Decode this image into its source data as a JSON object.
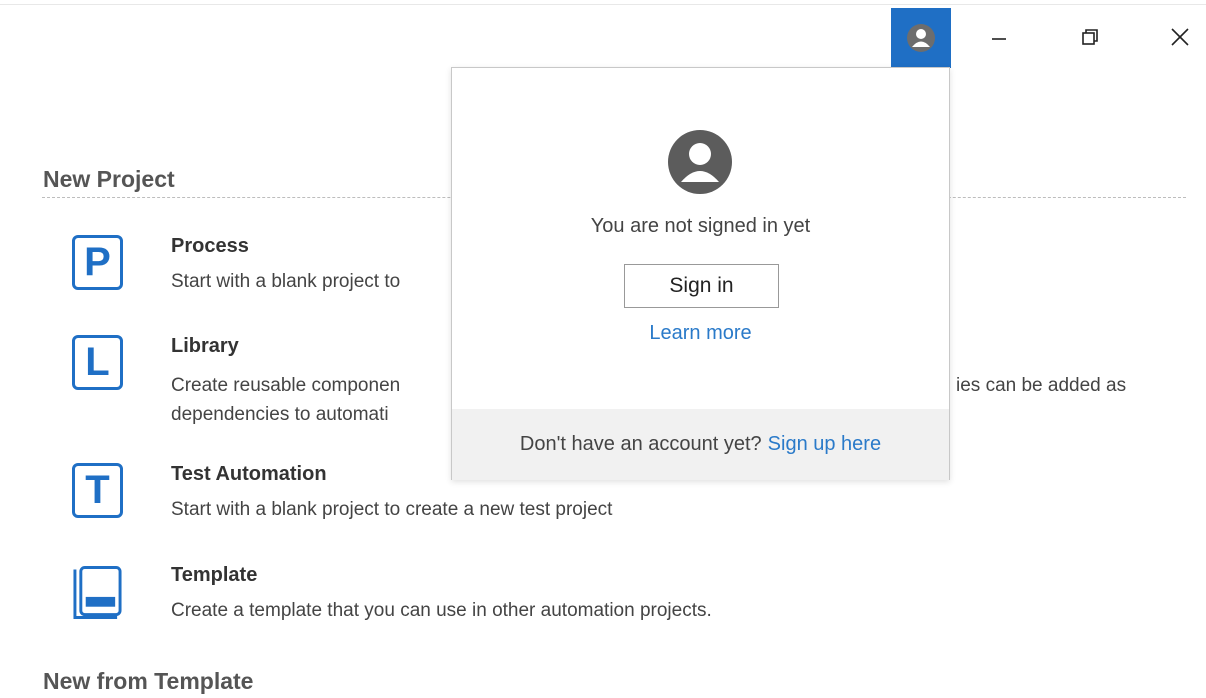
{
  "titlebar": {
    "icons": [
      "account-icon",
      "minimize-icon",
      "restore-icon",
      "close-icon"
    ]
  },
  "new_project": {
    "title": "New Project",
    "items": [
      {
        "icon_letter": "P",
        "name": "Process",
        "description": "Start with a blank project to"
      },
      {
        "icon_letter": "L",
        "name": "Library",
        "description_line1": "Create reusable componen",
        "description_line1_right": "ies can be added as",
        "description_line2": "dependencies to automati"
      },
      {
        "icon_letter": "T",
        "name": "Test Automation",
        "description": "Start with a blank project to create a new test project"
      },
      {
        "icon_letter": "",
        "name": "Template",
        "description": "Create a template that you can use in other automation projects."
      }
    ]
  },
  "new_from_template": {
    "title": "New from Template"
  },
  "account_popup": {
    "message": "You are not signed in yet",
    "sign_in_label": "Sign in",
    "learn_more_label": "Learn more",
    "footer_text": "Don't have an account yet?",
    "footer_link": "Sign up here"
  },
  "colors": {
    "accent": "#1f6fc5",
    "link": "#2a7ac9"
  }
}
